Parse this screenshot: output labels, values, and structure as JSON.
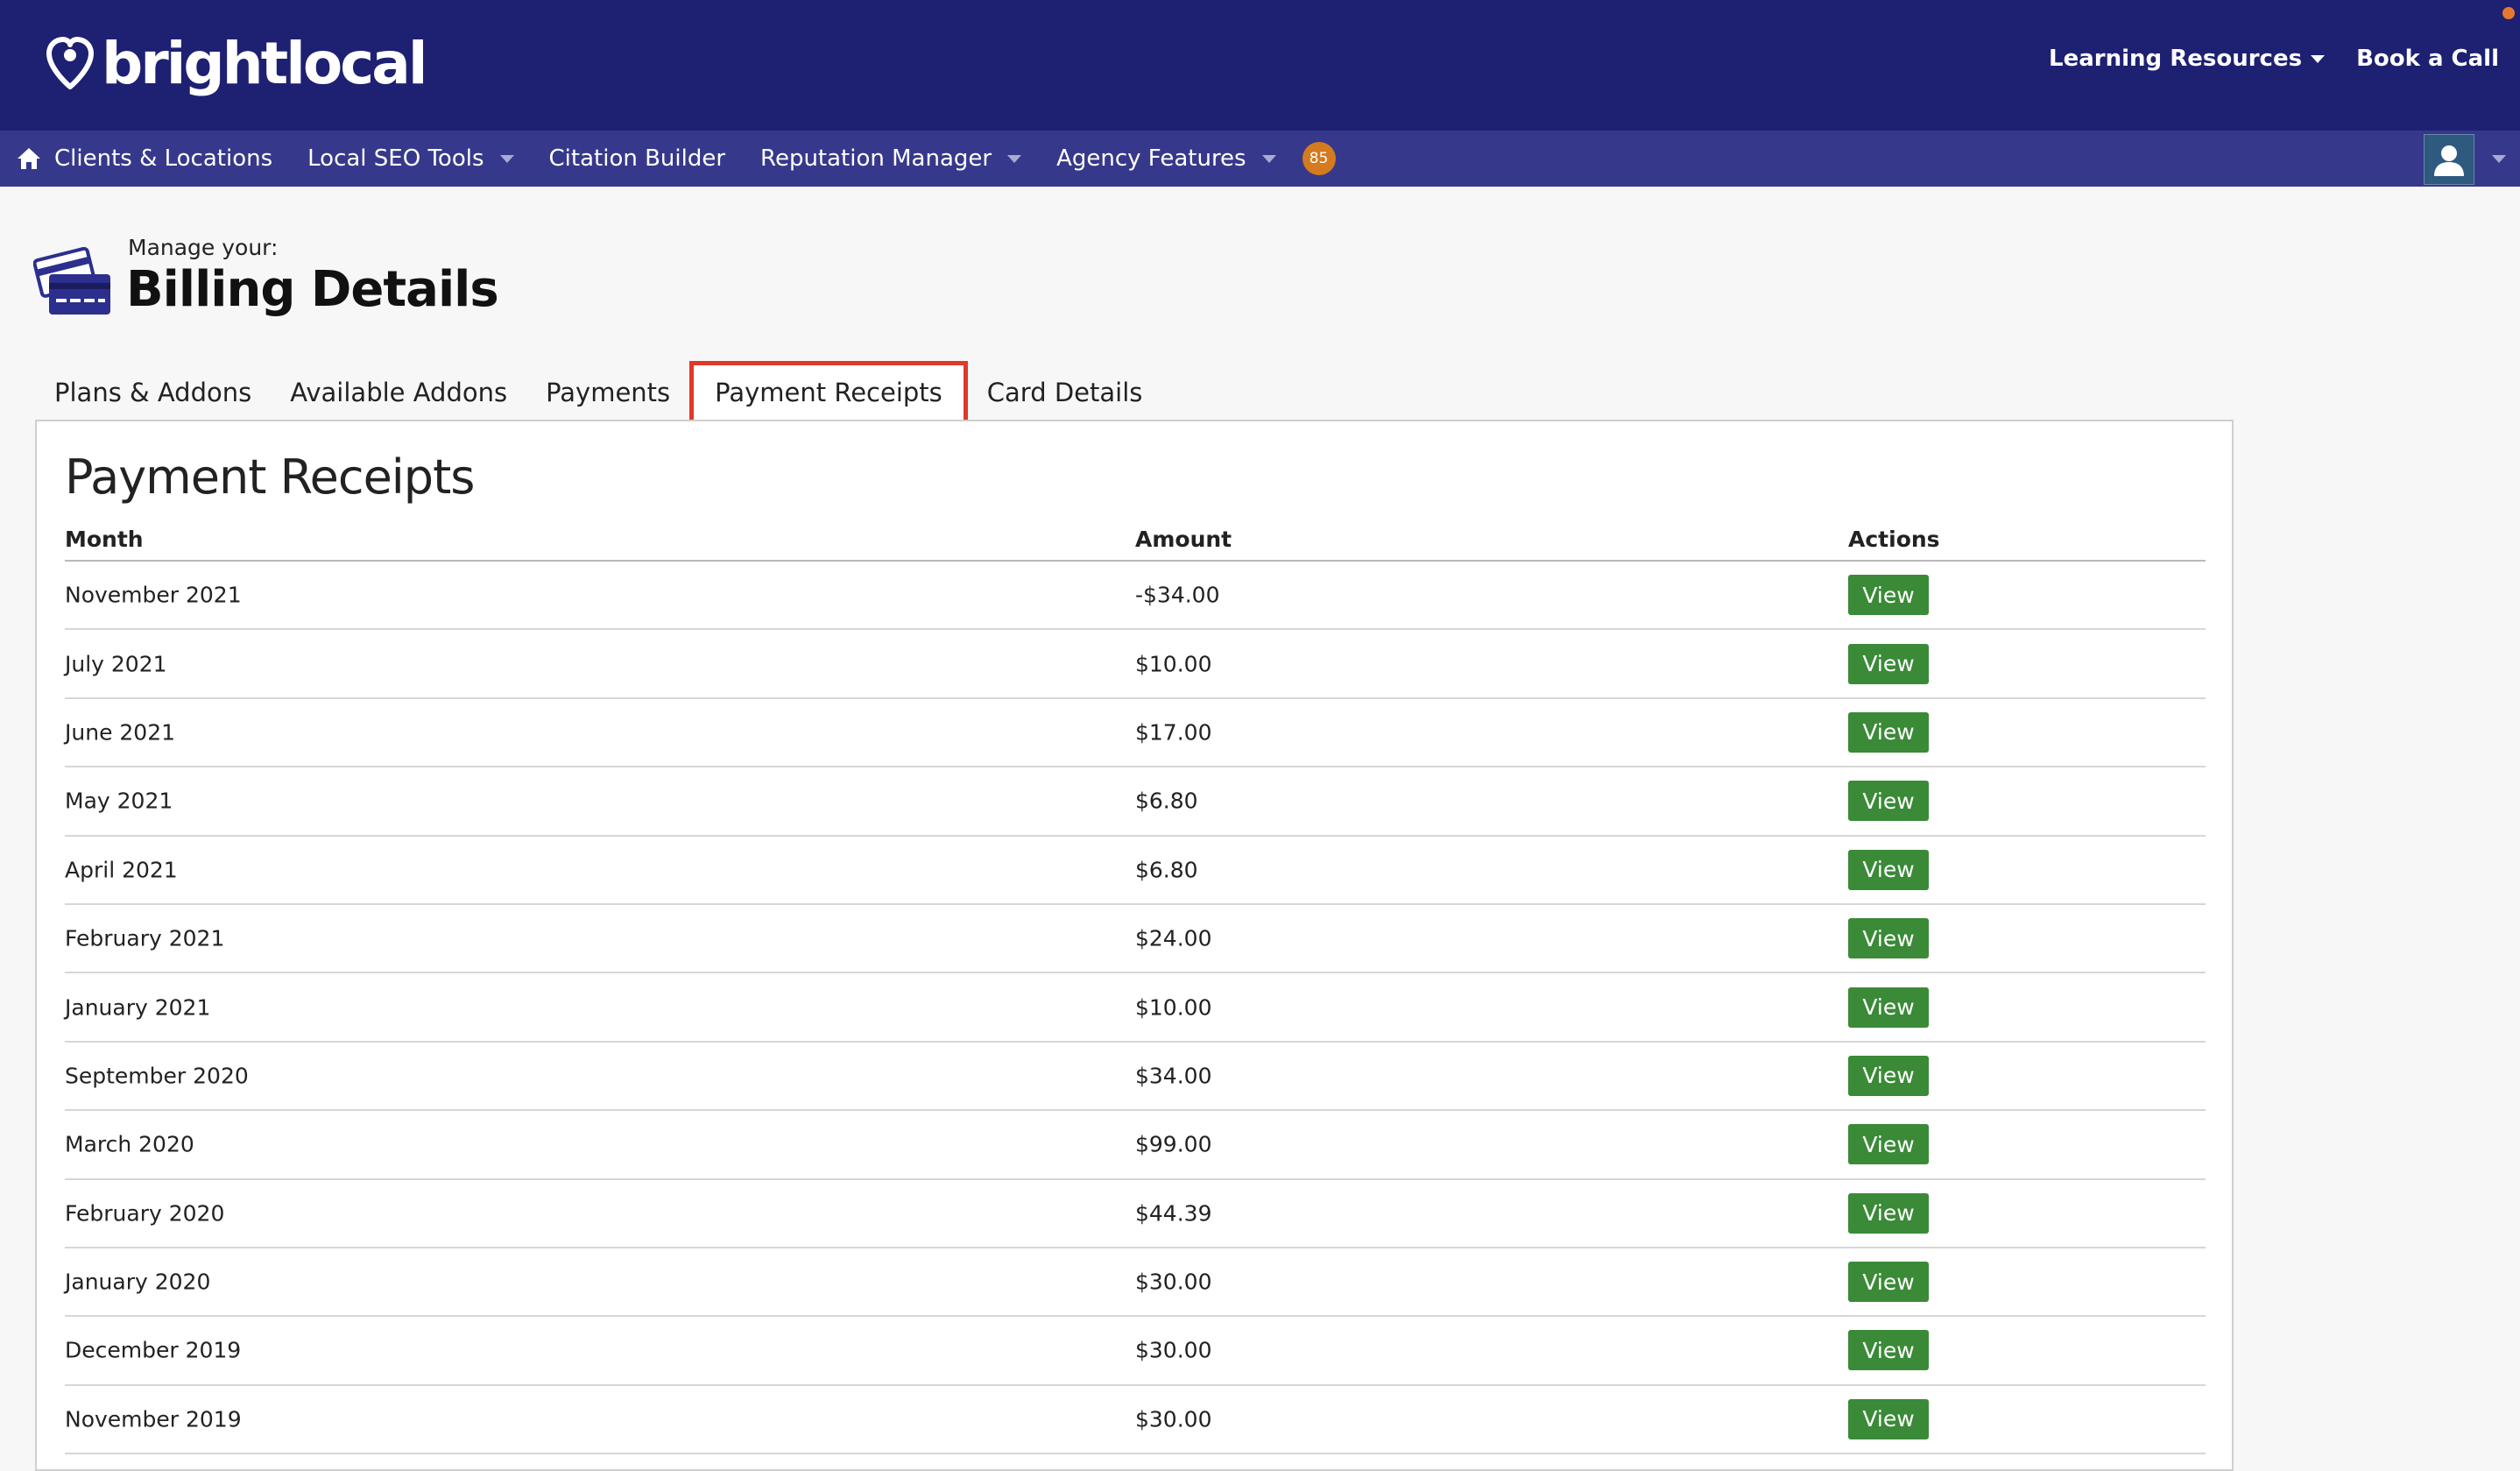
{
  "app": {
    "logo_text": "brightlocal",
    "top_links": {
      "learning_resources": "Learning Resources",
      "book_call": "Book a Call"
    }
  },
  "nav": {
    "items": [
      {
        "label": "Clients & Locations",
        "icon": "home-icon",
        "dropdown": false
      },
      {
        "label": "Local SEO Tools",
        "dropdown": true
      },
      {
        "label": "Citation Builder",
        "dropdown": false
      },
      {
        "label": "Reputation Manager",
        "dropdown": true
      },
      {
        "label": "Agency Features",
        "dropdown": true
      }
    ],
    "badge_count": "85",
    "user_icon": "user-avatar-icon"
  },
  "page": {
    "manage_label": "Manage your:",
    "title": "Billing Details",
    "icon": "credit-card-icon"
  },
  "tabs": [
    {
      "label": "Plans & Addons",
      "active": false
    },
    {
      "label": "Available Addons",
      "active": false
    },
    {
      "label": "Payments",
      "active": false
    },
    {
      "label": "Payment Receipts",
      "active": true
    },
    {
      "label": "Card Details",
      "active": false
    }
  ],
  "receipts": {
    "title": "Payment Receipts",
    "columns": {
      "month": "Month",
      "amount": "Amount",
      "actions": "Actions"
    },
    "action_label": "View",
    "rows": [
      {
        "month": "November 2021",
        "amount": "-$34.00"
      },
      {
        "month": "July 2021",
        "amount": "$10.00"
      },
      {
        "month": "June 2021",
        "amount": "$17.00"
      },
      {
        "month": "May 2021",
        "amount": "$6.80"
      },
      {
        "month": "April 2021",
        "amount": "$6.80"
      },
      {
        "month": "February 2021",
        "amount": "$24.00"
      },
      {
        "month": "January 2021",
        "amount": "$10.00"
      },
      {
        "month": "September 2020",
        "amount": "$34.00"
      },
      {
        "month": "March 2020",
        "amount": "$99.00"
      },
      {
        "month": "February 2020",
        "amount": "$44.39"
      },
      {
        "month": "January 2020",
        "amount": "$30.00"
      },
      {
        "month": "December 2019",
        "amount": "$30.00"
      },
      {
        "month": "November 2019",
        "amount": "$30.00"
      }
    ]
  },
  "colors": {
    "header_bg": "#1e2072",
    "nav_bg": "#36398b",
    "view_button": "#3a8a37",
    "active_tab_border": "#e0392a",
    "badge": "#d47a1f"
  }
}
